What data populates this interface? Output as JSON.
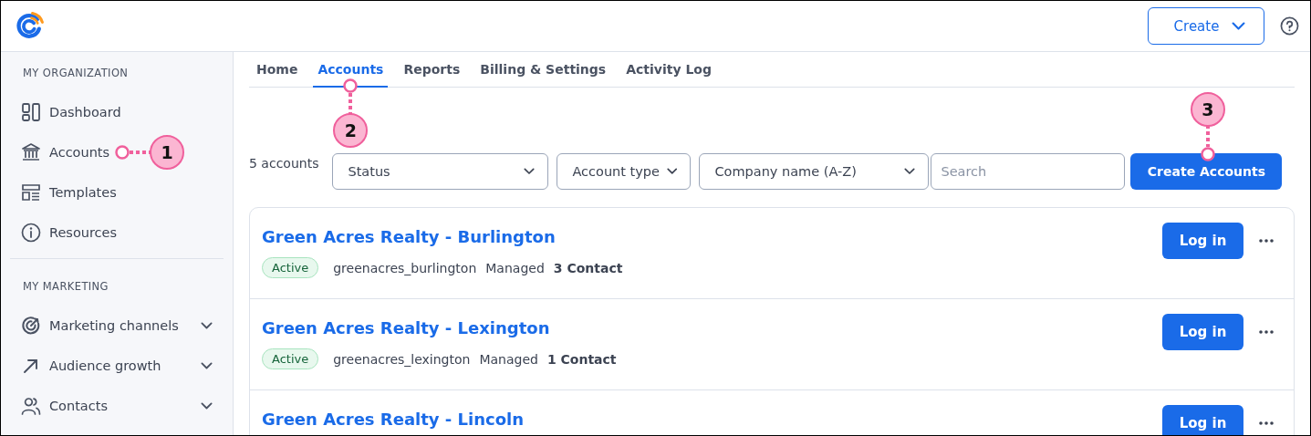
{
  "header": {
    "create_button": {
      "label": "Create"
    }
  },
  "sidebar": {
    "sections": [
      {
        "title": "MY ORGANIZATION",
        "items": [
          {
            "label": "Dashboard",
            "kind": "dashboard",
            "expandable": false
          },
          {
            "label": "Accounts",
            "kind": "bank",
            "expandable": false,
            "callout": "1"
          },
          {
            "label": "Templates",
            "kind": "templates",
            "expandable": false
          },
          {
            "label": "Resources",
            "kind": "info",
            "expandable": false
          }
        ]
      },
      {
        "title": "MY MARKETING",
        "items": [
          {
            "label": "Marketing channels",
            "kind": "target",
            "expandable": true
          },
          {
            "label": "Audience growth",
            "kind": "arrow",
            "expandable": true
          },
          {
            "label": "Contacts",
            "kind": "people",
            "expandable": true
          }
        ]
      }
    ]
  },
  "tabs": [
    {
      "label": "Home",
      "selected": false
    },
    {
      "label": "Accounts",
      "selected": true,
      "callout": "2"
    },
    {
      "label": "Reports",
      "selected": false
    },
    {
      "label": "Billing & Settings",
      "selected": false
    },
    {
      "label": "Activity Log",
      "selected": false
    }
  ],
  "toolbar": {
    "count": "5 accounts",
    "filters": [
      {
        "label": "Status"
      },
      {
        "label": "Account type"
      },
      {
        "label": "Company name (A-Z)"
      }
    ],
    "search": {
      "placeholder": "Search"
    },
    "create_button": {
      "label": "Create Accounts",
      "callout": "3"
    }
  },
  "accounts": [
    {
      "name": "Green Acres Realty - Burlington",
      "status": "Active",
      "username": "greenacres_burlington",
      "type": "Managed",
      "contacts": "3 Contact",
      "action": "Log in"
    },
    {
      "name": "Green Acres Realty - Lexington",
      "status": "Active",
      "username": "greenacres_lexington",
      "type": "Managed",
      "contacts": "1 Contact",
      "action": "Log in"
    },
    {
      "name": "Green Acres Realty - Lincoln",
      "action": "Log in"
    }
  ]
}
